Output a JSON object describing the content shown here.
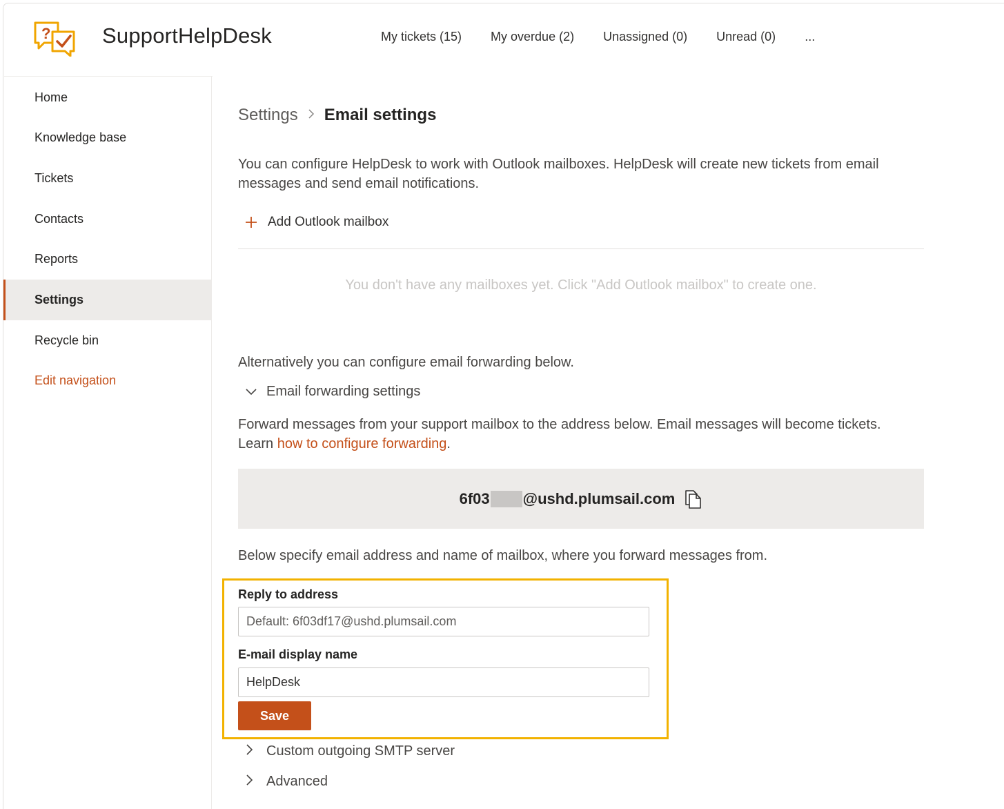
{
  "app": {
    "title": "SupportHelpDesk"
  },
  "topnav": [
    "My tickets (15)",
    "My overdue (2)",
    "Unassigned (0)",
    "Unread (0)",
    "..."
  ],
  "sidebar": {
    "items": [
      {
        "label": "Home"
      },
      {
        "label": "Knowledge base"
      },
      {
        "label": "Tickets"
      },
      {
        "label": "Contacts"
      },
      {
        "label": "Reports"
      },
      {
        "label": "Settings",
        "active": true
      },
      {
        "label": "Recycle bin"
      }
    ],
    "edit_label": "Edit navigation"
  },
  "breadcrumb": {
    "root": "Settings",
    "current": "Email settings"
  },
  "main": {
    "intro": "You can configure HelpDesk to work with Outlook mailboxes. HelpDesk will create new tickets from email messages and send email notifications.",
    "add_mailbox": "Add Outlook mailbox",
    "empty_message": "You don't have any mailboxes yet. Click \"Add Outlook mailbox\" to create one.",
    "alternative": "Alternatively you can configure email forwarding below.",
    "forwarding_section": "Email forwarding settings",
    "forward_text": "Forward messages from your support mailbox to the address below. Email messages will become tickets.",
    "learn_prefix": "Learn ",
    "learn_link": "how to configure forwarding",
    "learn_suffix": ".",
    "forward_address_prefix": "6f03",
    "forward_address_suffix": "@ushd.plumsail.com",
    "below_text": "Below specify email address and name of mailbox, where you forward messages from.",
    "reply_label": "Reply to address",
    "reply_placeholder": "Default: 6f03df17@ushd.plumsail.com",
    "reply_value": "",
    "display_label": "E-mail display name",
    "display_value": "HelpDesk",
    "save_label": "Save",
    "smtp_section": "Custom outgoing SMTP server",
    "advanced_section": "Advanced"
  },
  "colors": {
    "accent": "#c4501a",
    "highlight": "#f2b200",
    "logo": "#f0a500"
  },
  "icons": [
    "logo-icon",
    "plus-icon",
    "chevron-down-icon",
    "chevron-right-icon",
    "copy-icon"
  ]
}
